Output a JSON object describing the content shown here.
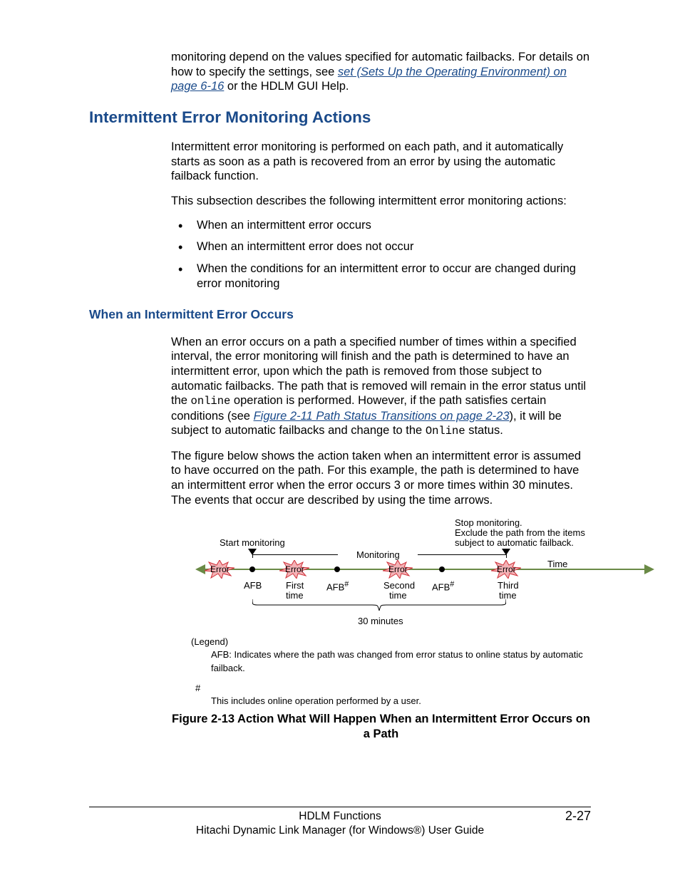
{
  "intro": {
    "p1a": "monitoring depend on the values specified for automatic failbacks. For details on how to specify the settings, see ",
    "link1": "set (Sets Up the Operating Environment) on page 6-16",
    "p1b": " or the HDLM GUI Help."
  },
  "section_title": "Intermittent Error Monitoring Actions",
  "sec": {
    "p1": "Intermittent error monitoring is performed on each path, and it automatically starts as soon as a path is recovered from an error by using the automatic failback function.",
    "p2": "This subsection describes the following intermittent error monitoring actions:",
    "bullets": [
      "When an intermittent error occurs",
      "When an intermittent error does not occur",
      "When the conditions for an intermittent error to occur are changed during error monitoring"
    ]
  },
  "subsection_title": "When an Intermittent Error Occurs",
  "sub": {
    "p1a": "When an error occurs on a path a specified number of times within a specified interval, the error monitoring will finish and the path is determined to have an intermittent error, upon which the path is removed from those subject to automatic failbacks. The path that is removed will remain in the error status until the ",
    "code1": "online",
    "p1b": " operation is performed. However, if the path satisfies certain conditions (see ",
    "link2": "Figure 2-11 Path Status Transitions on page 2-23",
    "p1c": "), it will be subject to automatic failbacks and change to the ",
    "code2": "Online",
    "p1d": " status.",
    "p2": "The figure below shows the action taken when an intermittent error is assumed to have occurred on the path. For this example, the path is determined to have an intermittent error when the error occurs 3 or more times within 30 minutes. The events that occur are described by using the time arrows."
  },
  "diagram": {
    "start_monitoring": "Start monitoring",
    "stop1": "Stop monitoring.",
    "stop2": "Exclude the path from the  items",
    "stop3": "subject to automatic failback.",
    "monitoring": "Monitoring",
    "time": "Time",
    "error": "Error",
    "afb": "AFB",
    "afb_hash": "AFB",
    "first": "First",
    "second": "Second",
    "third": "Third",
    "time_word": "time",
    "thirty": "30 minutes",
    "hash": "#"
  },
  "legend": {
    "title": "(Legend)",
    "afb": "AFB: Indicates where the path was changed from error status to online status by automatic failback.",
    "hash": "#",
    "hashtext": "This includes online operation performed by a user."
  },
  "caption": "Figure 2-13 Action What Will Happen When an Intermittent Error Occurs on a Path",
  "footer": {
    "section": "HDLM Functions",
    "book": "Hitachi Dynamic Link Manager (for Windows®) User Guide",
    "page": "2-27"
  }
}
